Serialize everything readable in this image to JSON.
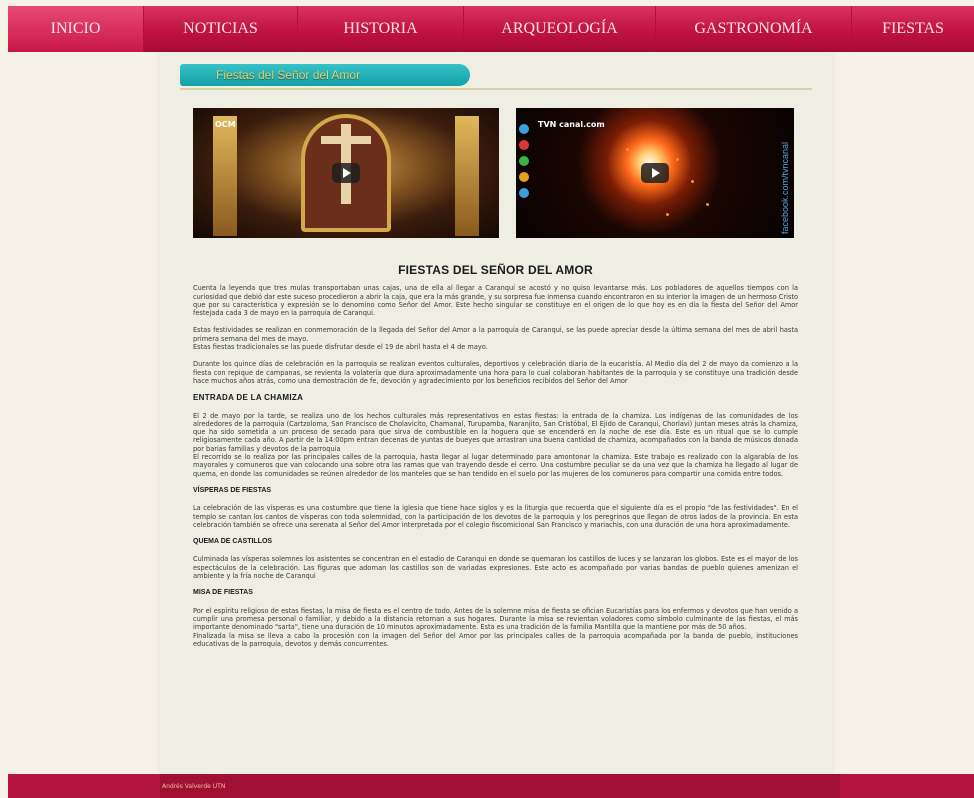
{
  "nav": {
    "items": [
      {
        "label": "INICIO",
        "active": true
      },
      {
        "label": "NOTICIAS"
      },
      {
        "label": "HISTORIA"
      },
      {
        "label": "ARQUEOLOGÍA"
      },
      {
        "label": "GASTRONOMÍA"
      },
      {
        "label": "FIESTAS"
      }
    ]
  },
  "section": {
    "tab_title": "Fiestas del Señor del Amor"
  },
  "videos": [
    {
      "channel_logo": "OCM",
      "icon": "play-icon"
    },
    {
      "channel_logo": "TVN canal.com",
      "icon": "play-icon",
      "side_text": "facebook.com/tvncanal"
    }
  ],
  "article": {
    "title": "FIESTAS DEL SEÑOR DEL AMOR",
    "p1": "Cuenta la leyenda que tres mulas transportaban unas cajas, una de ella al llegar a Caranqui se acostó y no quiso levantarse más. Los pobladores de aquellos tiempos con la curiosidad que debió dar este suceso procedieron a abrir la caja, que era la más grande, y su sorpresa fue inmensa cuando encontraron en su interior la imagen de un hermoso Cristo que por su característica y expresión se lo denomino como Señor del Amor. Este hecho singular se constituye en el origen de lo que hoy es en día la fiesta del Señor del Amor festejada cada 3 de mayo en la parroquia de Caranqui.",
    "p2": "Estas festividades se realizan en conmemoración de la llegada del Señor del Amor a la parroquia de Caranqui, se las puede apreciar desde la última semana del mes de abril hasta primera semana del mes de mayo.",
    "p2b": "Estas fiestas tradicionales se las puede disfrutar desde el 19 de abril hasta el 4 de mayo.",
    "p3": "Durante los quince días de celebración en la parroquia se realizan eventos culturales, deportivos y celebración diaria de la eucaristía. Al Medio día del 2 de mayo da comienzo a la fiesta con repique de campanas, se revienta la volatería que dura aproximadamente una hora para lo cual colaboran habitantes de la parroquia y se constituye una tradición desde hace muchos años atrás, como una demostración de fe, devoción y agradecimiento por los beneficios recibidos del Señor del Amor",
    "h_chamiza": "ENTRADA DE LA CHAMIZA",
    "p4": "El 2 de mayo por la tarde, se realiza uno de los hechos culturales más representativos en estas fiestas: la entrada de la chamiza. Los indígenas de las comunidades de los alrededores de la parroquia (Cartzoloma, San Francisco de Cholavicito, Chamanal, Turupamba, Naranjito, San Cristóbal, El Ejido de Caranqui, Chorlavi) juntan meses atrás la chamiza, que ha sido sometida a un proceso de secado para que sirva de combustible en la hoguera que se encenderá en la noche de ese día. Este es un ritual que se lo cumple religiosamente cada año. A partir de la 14:00pm entran decenas de yuntas de bueyes que arrastran una buena cantidad de chamiza, acompañados con la banda de músicos donada por barias familias y devotos de la parroquia",
    "p5": "El recorrido se lo realiza por las principales calles de la parroquia, hasta llegar al lugar determinado para amontonar la chamiza. Este trabajo es realizado con la algarabía de los mayorales y comuneros que van colocando una sobre otra las ramas que van trayendo desde el cerro. Una costumbre peculiar se da una vez que la chamiza ha llegado al lugar de quema, en donde las comunidades se reúnen alrededor de los manteles que se han tendido en el suelo por las mujeres de los comuneros para compartir una comida entre todos.",
    "h_visperas": "VÍSPERAS DE FIESTAS",
    "p6": "La celebración de las vísperas es una costumbre que tiene la iglesia que tiene hace siglos y es la liturgia que recuerda que el siguiente día es el propio \"de las festividades\". En el templo se cantan los cantos de vísperas con toda solemnidad, con la participación de los devotos de la parroquia y los peregrinos que llegan de otros lados de la provincia. En esta celebración también se ofrece una serenata al Señor del Amor interpretada por el colegio fiscomicional San Francisco y mariachis, con una duración de una hora aproximadamente.",
    "h_castillos": "QUEMA DE CASTILLOS",
    "p7": "Culminada las vísperas solemnes los asistentes se concentran en el estadio de Caranqui en donde se quemaran los castillos de luces y se lanzaran los globos. Este es el mayor de los espectáculos de la celebración. Las figuras que adornan los castillos son de variadas expresiones. Este acto es acompañado por varias bandas de pueblo quienes amenizan el ambiente y la fría noche de Caranqui",
    "h_misa": "MISA DE FIESTAS",
    "p8": "Por el espíritu religioso de estas fiestas, la misa de fiesta es el centro de todo. Antes de la solemne misa de fiesta se ofician Eucaristías para los enfermos y devotos que han venido a cumplir una promesa personal o familiar, y debido a la distancia retornan a sus hogares. Durante la misa se revientan voladores como símbolo culminante de las fiestas, el más importante denominado \"sarta\", tiene una duración de 10 minutos aproximadamente. Esta es una tradición de la familia Mantilla que la mantiene por más de 50 años.",
    "p9": "Finalizada la misa se lleva a cabo la procesión con la imagen del Señor del Amor por las principales calles de la parroquia acompañada por la banda de pueblo, instituciones educativas de la parroquia, devotos y demás concurrentes."
  },
  "footer": {
    "text": "Andrés Valverde UTN"
  },
  "colors": {
    "nav": "#c1123f",
    "tab": "#1ab0b6",
    "background": "#f6f3e6",
    "content": "#eeeee2"
  }
}
